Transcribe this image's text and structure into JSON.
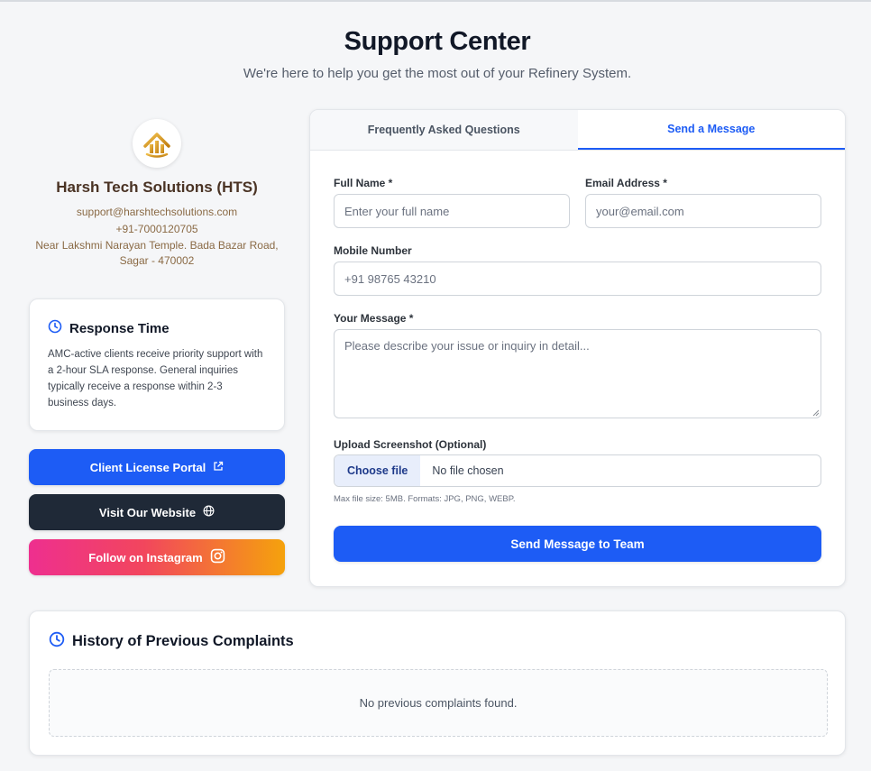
{
  "header": {
    "title": "Support Center",
    "subtitle": "We're here to help you get the most out of your Refinery System."
  },
  "company": {
    "name": "Harsh Tech Solutions (HTS)",
    "email": "support@harshtechsolutions.com",
    "phone": "+91-7000120705",
    "address_line1": "Near Lakshmi Narayan Temple. Bada Bazar Road,",
    "address_line2": "Sagar - 470002"
  },
  "response": {
    "title": "Response Time",
    "description": "AMC-active clients receive priority support with a 2-hour SLA response. General inquiries typically receive a response within 2-3 business days."
  },
  "buttons": {
    "license": "Client License Portal",
    "website": "Visit Our Website",
    "instagram": "Follow on Instagram"
  },
  "tabs": {
    "faq": "Frequently Asked Questions",
    "message": "Send a Message",
    "active": "message"
  },
  "form": {
    "full_name_label": "Full Name *",
    "full_name_placeholder": "Enter your full name",
    "email_label": "Email Address *",
    "email_placeholder": "your@email.com",
    "mobile_label": "Mobile Number",
    "mobile_placeholder": "+91 98765 43210",
    "message_label": "Your Message *",
    "message_placeholder": "Please describe your issue or inquiry in detail...",
    "upload_label": "Upload Screenshot (Optional)",
    "choose_file": "Choose file",
    "no_file": "No file chosen",
    "upload_hint": "Max file size: 5MB. Formats: JPG, PNG, WEBP.",
    "submit": "Send Message to Team"
  },
  "history": {
    "title": "History of Previous Complaints",
    "empty": "No previous complaints found."
  },
  "colors": {
    "primary": "#1d5cf5",
    "dark": "#1f2937",
    "brand_brown": "#4a3324",
    "contact_text": "#8a6a45",
    "logo_gold": "#d89a1c"
  }
}
